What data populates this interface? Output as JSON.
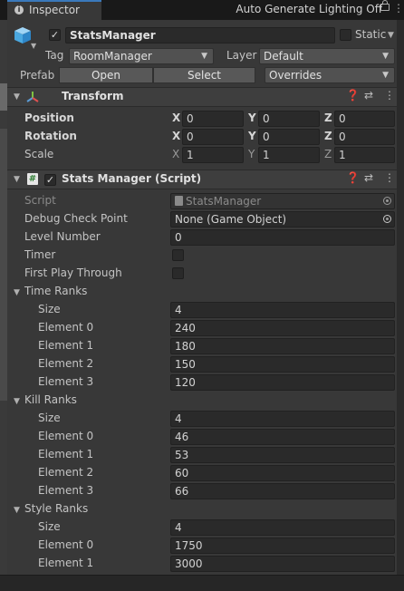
{
  "tab": {
    "title": "Inspector"
  },
  "header": {
    "active_checked": true,
    "object_name": "StatsManager",
    "static_label": "Static",
    "tag_label": "Tag",
    "tag_value": "RoomManager",
    "layer_label": "Layer",
    "layer_value": "Default",
    "prefab_label": "Prefab",
    "open_label": "Open",
    "select_label": "Select",
    "overrides_label": "Overrides"
  },
  "transform": {
    "title": "Transform",
    "position": {
      "label": "Position",
      "x": "0",
      "y": "0",
      "z": "0"
    },
    "rotation": {
      "label": "Rotation",
      "x": "0",
      "y": "0",
      "z": "0"
    },
    "scale": {
      "label": "Scale",
      "x": "1",
      "y": "1",
      "z": "1"
    },
    "axis_x": "X",
    "axis_y": "Y",
    "axis_z": "Z"
  },
  "script_component": {
    "title": "Stats Manager (Script)",
    "enabled": true,
    "script_label": "Script",
    "script_value": "StatsManager",
    "debug_label": "Debug Check Point",
    "debug_value": "None (Game Object)",
    "level_label": "Level Number",
    "level_value": "0",
    "timer_label": "Timer",
    "first_play_label": "First Play Through",
    "size_label": "Size",
    "time_ranks": {
      "label": "Time Ranks",
      "size": "4",
      "elements": [
        {
          "label": "Element 0",
          "value": "240"
        },
        {
          "label": "Element 1",
          "value": "180"
        },
        {
          "label": "Element 2",
          "value": "150"
        },
        {
          "label": "Element 3",
          "value": "120"
        }
      ]
    },
    "kill_ranks": {
      "label": "Kill Ranks",
      "size": "4",
      "elements": [
        {
          "label": "Element 0",
          "value": "46"
        },
        {
          "label": "Element 1",
          "value": "53"
        },
        {
          "label": "Element 2",
          "value": "60"
        },
        {
          "label": "Element 3",
          "value": "66"
        }
      ]
    },
    "style_ranks": {
      "label": "Style Ranks",
      "size": "4",
      "elements": [
        {
          "label": "Element 0",
          "value": "1750"
        },
        {
          "label": "Element 1",
          "value": "3000"
        }
      ]
    }
  },
  "status": {
    "text": "Auto Generate Lighting Off"
  },
  "colors": {
    "accent": "#3a79bb",
    "panel": "#383838",
    "field": "#2a2a2a"
  }
}
